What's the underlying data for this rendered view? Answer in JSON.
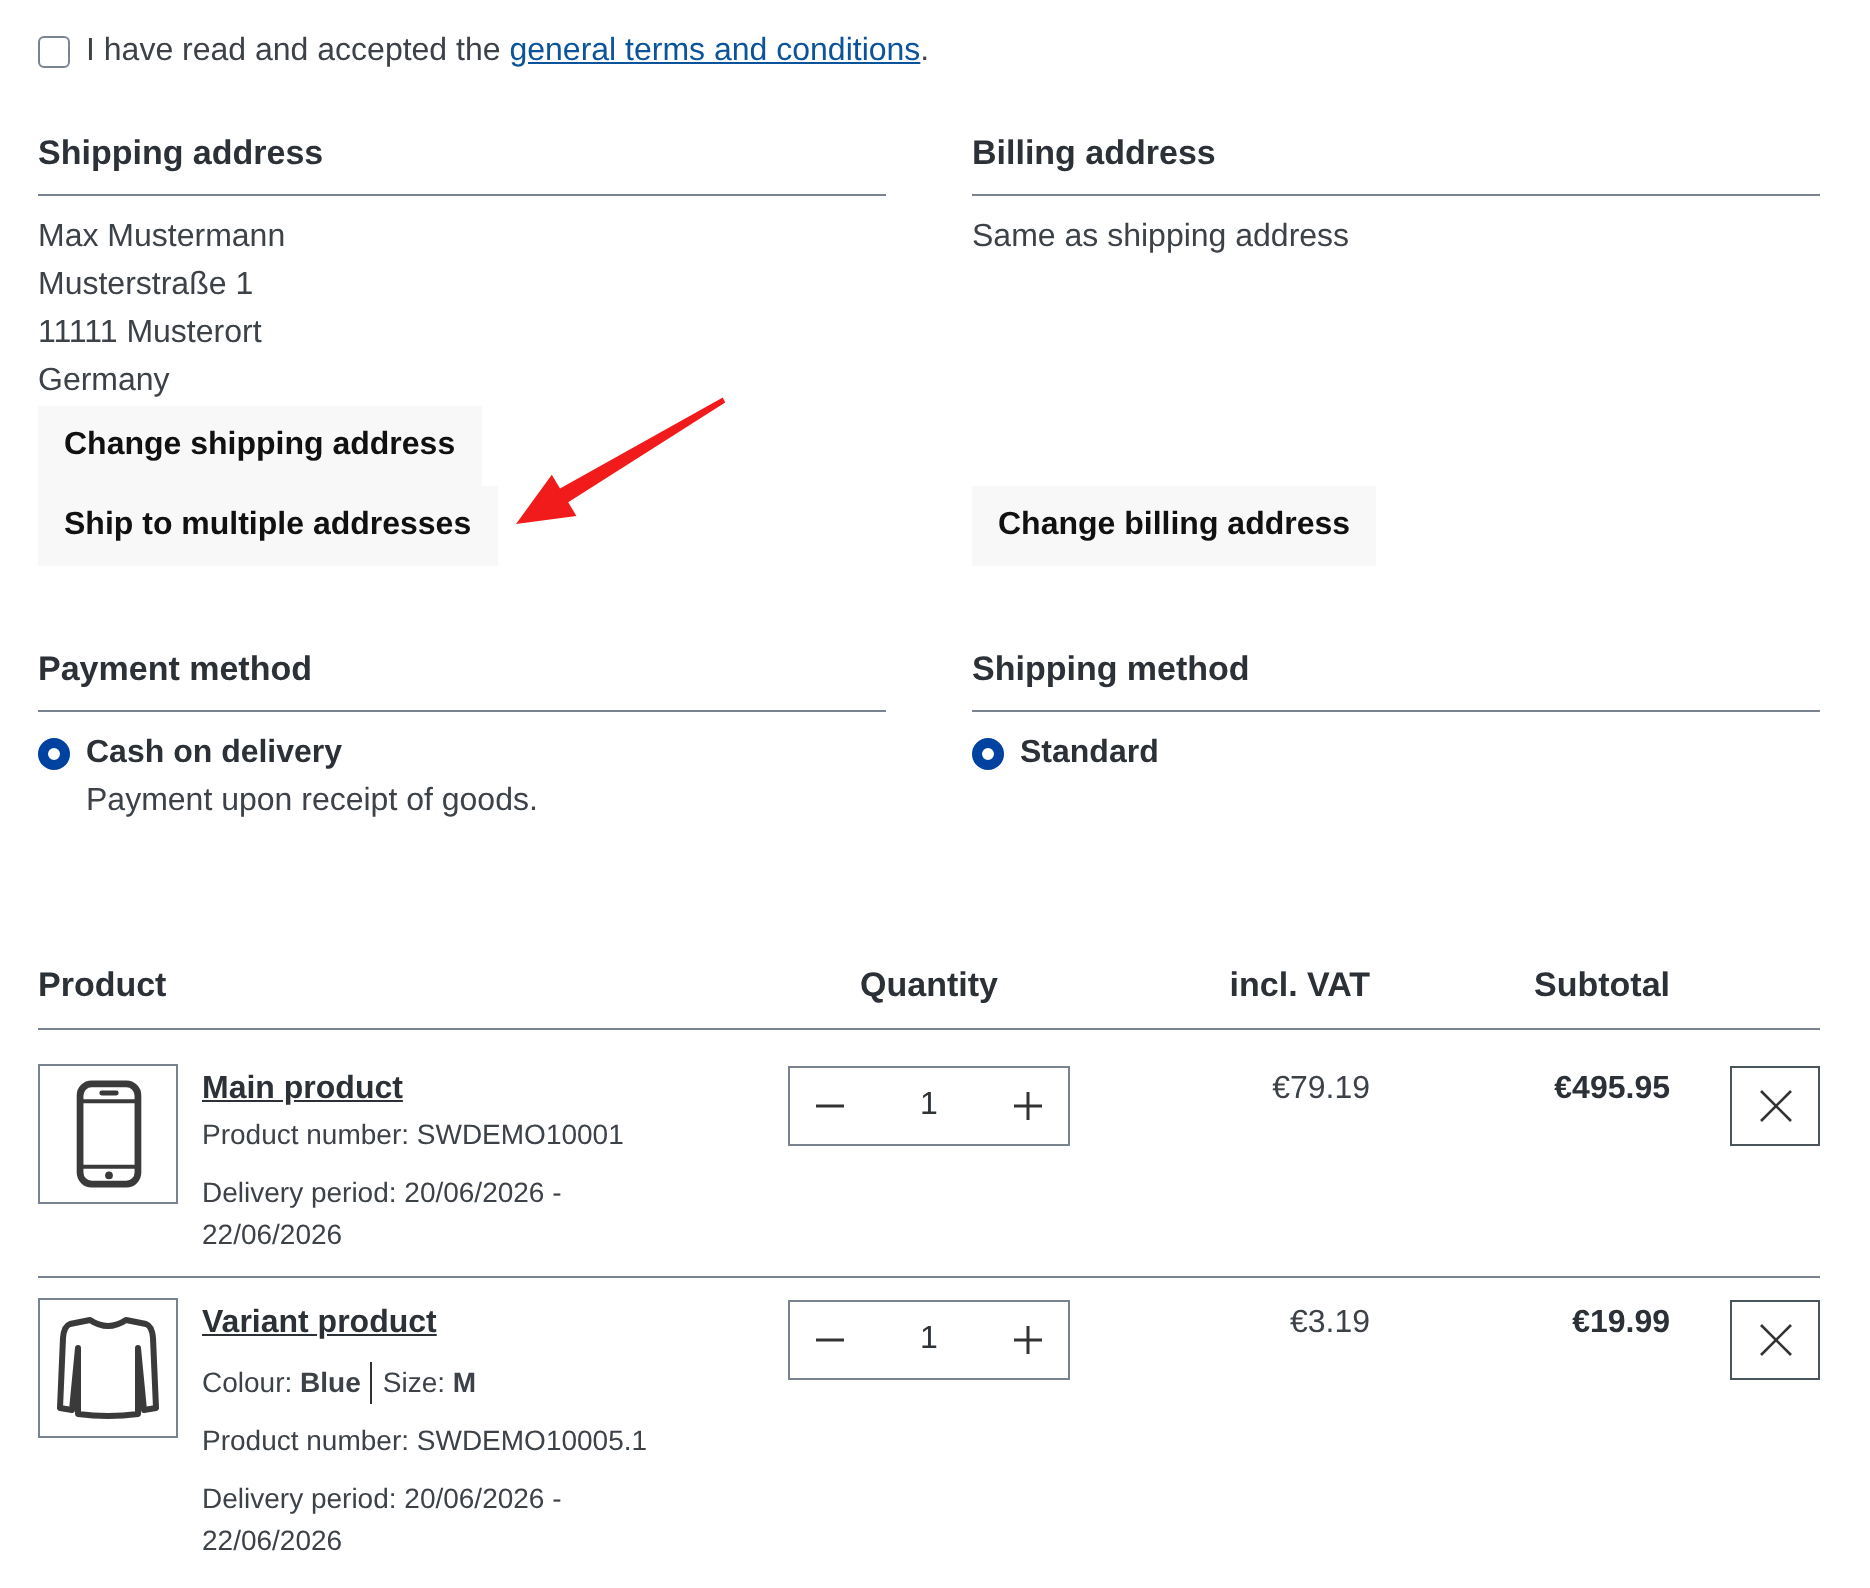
{
  "terms": {
    "checked": false,
    "text": "I have read and accepted the ",
    "link": "general terms and conditions",
    "after": "."
  },
  "addresses": [
    {
      "heading": "Shipping address",
      "lines": [
        "Max Mustermann",
        "Musterstraße 1",
        "11111 Musterort",
        "Germany"
      ],
      "buttons": [
        "Change shipping address",
        "Ship to multiple addresses"
      ]
    },
    {
      "heading": "Billing address",
      "lines": [
        "Same as shipping address"
      ],
      "buttons": [
        "Change billing address"
      ]
    }
  ],
  "methods": [
    {
      "heading": "Payment method",
      "options": [
        {
          "label": "Cash on delivery",
          "description": "Payment upon receipt of goods.",
          "selected": true
        }
      ]
    },
    {
      "heading": "Shipping method",
      "options": [
        {
          "label": "Standard",
          "selected": true
        }
      ]
    }
  ],
  "cart": {
    "columns": [
      "Product",
      "Quantity",
      "incl. VAT",
      "Subtotal"
    ],
    "items": [
      {
        "name": "Main product",
        "product_number": "Product number: SWDEMO10001",
        "delivery": "Delivery period: 20/06/2026 - 22/06/2026",
        "quantity": "1",
        "unit_price": "€79.19",
        "subtotal": "€495.95"
      },
      {
        "name": "Variant product",
        "options": [
          {
            "label": "Colour:",
            "value": "Blue"
          },
          {
            "label": "Size:",
            "value": "M"
          }
        ],
        "product_number": "Product number: SWDEMO10005.1",
        "delivery": "Delivery period: 20/06/2026 - 22/06/2026",
        "quantity": "1",
        "unit_price": "€3.19",
        "subtotal": "€19.99"
      }
    ]
  }
}
